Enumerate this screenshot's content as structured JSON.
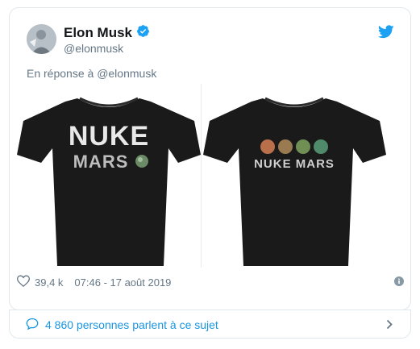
{
  "author": {
    "name": "Elon Musk",
    "handle": "@elonmusk",
    "verified": true,
    "avatar_icon": "avatar-photo"
  },
  "tweet": {
    "reply_prefix": "En réponse à",
    "reply_to": "@elonmusk",
    "media": [
      {
        "shirt_text_line1": "NUKE",
        "shirt_text_line2": "MARS",
        "color": "#1a1a1a"
      },
      {
        "shirt_text": "NUKE MARS",
        "color": "#1a1a1a"
      }
    ]
  },
  "meta": {
    "likes": "39,4 k",
    "timestamp": "07:46 - 17 août 2019"
  },
  "footer": {
    "people_talking": "4 860 personnes parlent à ce sujet"
  },
  "colors": {
    "accent": "#1da1f2",
    "link": "#1b95e0",
    "muted": "#657786",
    "border": "#e1e8ed"
  }
}
